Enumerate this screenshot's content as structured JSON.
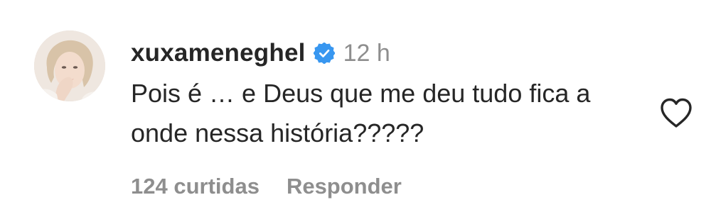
{
  "comment": {
    "username": "xuxameneghel",
    "verified": true,
    "timestamp": "12 h",
    "text": "Pois é … e Deus que me deu tudo fica a onde nessa história?????",
    "likes_label": "124 curtidas",
    "reply_label": "Responder"
  },
  "icons": {
    "avatar": "profile-photo",
    "verified": "verified-badge-icon",
    "like": "heart-outline-icon"
  },
  "colors": {
    "primary_text": "#262626",
    "secondary_text": "#8e8e8e",
    "verified_blue": "#3897f0",
    "background": "#ffffff"
  }
}
